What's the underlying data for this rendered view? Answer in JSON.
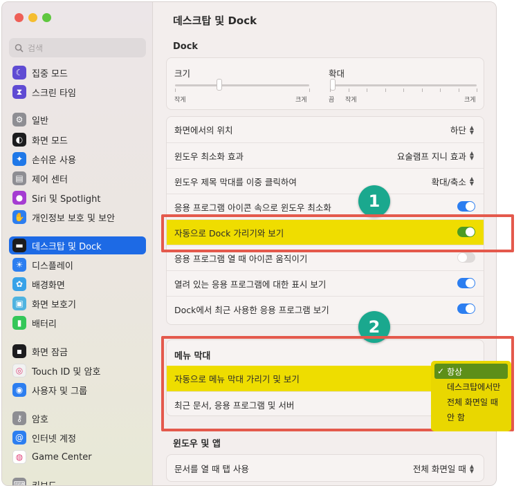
{
  "window": {
    "title": "데스크탑 및 Dock"
  },
  "search": {
    "placeholder": "검색"
  },
  "sidebar": {
    "items": [
      {
        "label": "집중 모드",
        "icon": "moon-icon",
        "color": "#5f4bd3"
      },
      {
        "label": "스크린 타임",
        "icon": "hourglass-icon",
        "color": "#5f4bd3"
      },
      {
        "label": "일반",
        "icon": "gear-icon",
        "color": "#8e8e93"
      },
      {
        "label": "화면 모드",
        "icon": "appearance-icon",
        "color": "#1c1c1e"
      },
      {
        "label": "손쉬운 사용",
        "icon": "accessibility-icon",
        "color": "#1f78e8"
      },
      {
        "label": "제어 센터",
        "icon": "control-center-icon",
        "color": "#8e8e93"
      },
      {
        "label": "Siri 및 Spotlight",
        "icon": "siri-icon",
        "color": "#a53cd2"
      },
      {
        "label": "개인정보 보호 및 보안",
        "icon": "hand-icon",
        "color": "#2c7ef0"
      },
      {
        "label": "데스크탑 및 Dock",
        "icon": "dock-icon",
        "color": "#1c1c1e"
      },
      {
        "label": "디스플레이",
        "icon": "sun-icon",
        "color": "#2c7ef0"
      },
      {
        "label": "배경화면",
        "icon": "flower-icon",
        "color": "#38a2e8"
      },
      {
        "label": "화면 보호기",
        "icon": "screensaver-icon",
        "color": "#4fb3e0"
      },
      {
        "label": "배터리",
        "icon": "battery-icon",
        "color": "#34c759"
      },
      {
        "label": "화면 잠금",
        "icon": "lock-icon",
        "color": "#1c1c1e"
      },
      {
        "label": "Touch ID 및 암호",
        "icon": "fingerprint-icon",
        "color": "#f2f2f2"
      },
      {
        "label": "사용자 및 그룹",
        "icon": "users-icon",
        "color": "#2c7ef0"
      },
      {
        "label": "암호",
        "icon": "key-icon",
        "color": "#8e8e93"
      },
      {
        "label": "인터넷 계정",
        "icon": "at-icon",
        "color": "#2c7ef0"
      },
      {
        "label": "Game Center",
        "icon": "game-center-icon",
        "color": "#ffffff"
      },
      {
        "label": "키보드",
        "icon": "keyboard-icon",
        "color": "#8e8e93"
      }
    ]
  },
  "dock": {
    "header": "Dock",
    "size": {
      "label": "크기",
      "min": "작게",
      "max": "크게",
      "level": 0.33
    },
    "magnify": {
      "label": "확대",
      "off": "끔",
      "min": "작게",
      "max": "크게",
      "level": 0.0
    },
    "rows": [
      {
        "label": "화면에서의 위치",
        "value": "하단"
      },
      {
        "label": "윈도우 최소화 효과",
        "value": "요술램프 지니 효과"
      },
      {
        "label": "윈도우 제목 막대를 이중 클릭하여",
        "value": "확대/축소"
      },
      {
        "label": "응용 프로그램 아이콘 속으로 윈도우 최소화",
        "toggle": true
      },
      {
        "label": "자동으로 Dock 가리기와 보기",
        "toggle": true
      },
      {
        "label": "응용 프로그램 열 때 아이콘 움직이기",
        "toggle": false
      },
      {
        "label": "열려 있는 응용 프로그램에 대한 표시 보기",
        "toggle": true
      },
      {
        "label": "Dock에서 최근 사용한 응용 프로그램 보기",
        "toggle": true
      }
    ]
  },
  "menubar": {
    "header": "메뉴 막대",
    "rows": [
      {
        "label": "자동으로 메뉴 막대 가리기 및 보기"
      },
      {
        "label": "최근 문서, 응용 프로그램 및 서버"
      }
    ],
    "dropdown": {
      "check": "✓",
      "options": [
        "항상",
        "데스크탑에서만",
        "전체 화면일 때",
        "안 함"
      ],
      "selected": "항상"
    }
  },
  "windows": {
    "header": "윈도우 및 앱",
    "rows": [
      {
        "label": "문서를 열 때 탭 사용",
        "value": "전체 화면일 때"
      }
    ]
  },
  "callouts": [
    "1",
    "2"
  ]
}
